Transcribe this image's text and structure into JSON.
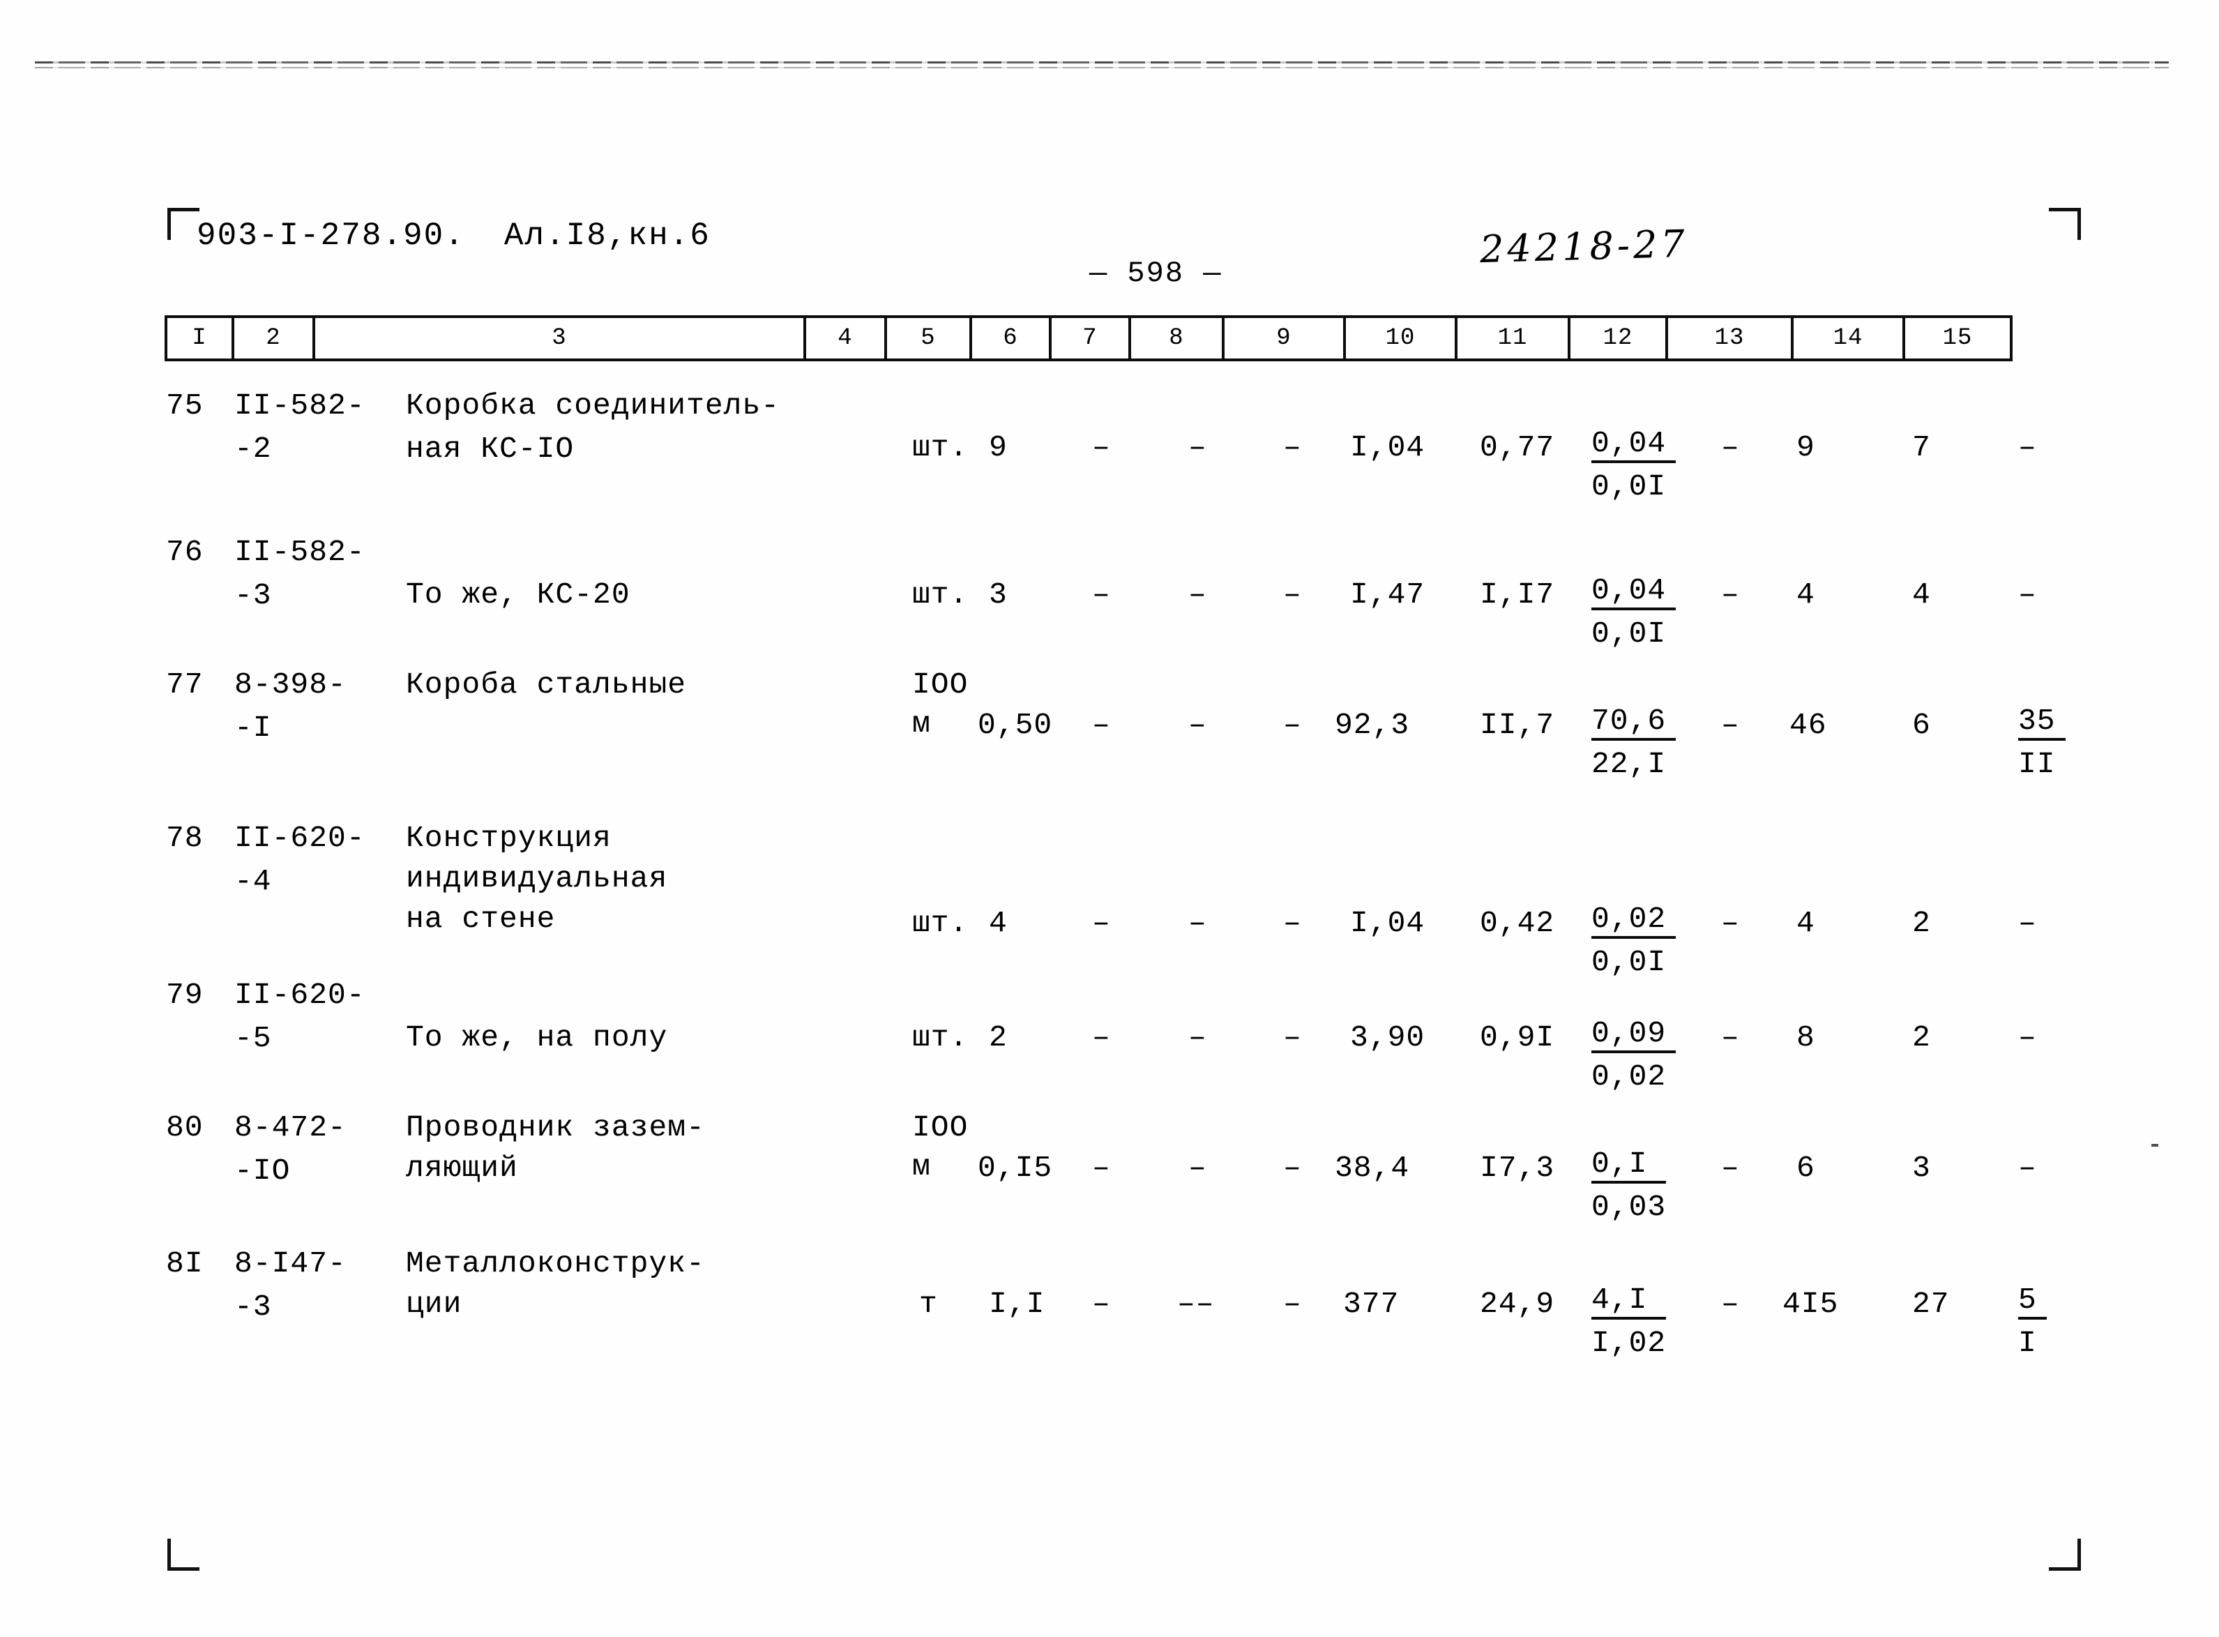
{
  "document": {
    "code": "903-I-278.90.",
    "album": "Ал.I8,кн.6",
    "page_label": "— 598 —",
    "stamp_number": "24218-27"
  },
  "table": {
    "column_headers": [
      "I",
      "2",
      "3",
      "4",
      "5",
      "6",
      "7",
      "8",
      "9",
      "10",
      "11",
      "12",
      "13",
      "14",
      "15"
    ],
    "rows": [
      {
        "num": "75",
        "code_line1": "II-582-",
        "code_line2": "-2",
        "name_line1": "Коробка соединитель-",
        "name_line2": "ная КС-IO",
        "name_line3": "",
        "unit_line1": "",
        "unit_line2": "шт.",
        "c5": "9",
        "c6": "–",
        "c7": "–",
        "c8": "–",
        "c9": "I,04",
        "c10": "0,77",
        "c11_top": "0,04",
        "c11_bot": "0,0I",
        "c12": "–",
        "c13": "9",
        "c14": "7",
        "c15_top": "–",
        "c15_bot": ""
      },
      {
        "num": "76",
        "code_line1": "II-582-",
        "code_line2": "-3",
        "name_line1": "",
        "name_line2": "То же, КС-20",
        "name_line3": "",
        "unit_line1": "",
        "unit_line2": "шт.",
        "c5": "3",
        "c6": "–",
        "c7": "–",
        "c8": "–",
        "c9": "I,47",
        "c10": "I,I7",
        "c11_top": "0,04",
        "c11_bot": "0,0I",
        "c12": "–",
        "c13": "4",
        "c14": "4",
        "c15_top": "–",
        "c15_bot": ""
      },
      {
        "num": "77",
        "code_line1": "8-398-",
        "code_line2": "-I",
        "name_line1": "Короба стальные",
        "name_line2": "",
        "name_line3": "",
        "unit_line1": "IOO",
        "unit_line2": "м",
        "c5": "0,50",
        "c6": "–",
        "c7": "–",
        "c8": "–",
        "c9": "92,3",
        "c10": "II,7",
        "c11_top": "70,6",
        "c11_bot": "22,I",
        "c12": "–",
        "c13": "46",
        "c14": "6",
        "c15_top": "35",
        "c15_bot": "II"
      },
      {
        "num": "78",
        "code_line1": "II-620-",
        "code_line2": "-4",
        "name_line1": "Конструкция",
        "name_line2": "индивидуальная",
        "name_line3": "на стене",
        "unit_line1": "",
        "unit_line2": "шт.",
        "c5": "4",
        "c6": "–",
        "c7": "–",
        "c8": "–",
        "c9": "I,04",
        "c10": "0,42",
        "c11_top": "0,02",
        "c11_bot": "0,0I",
        "c12": "–",
        "c13": "4",
        "c14": "2",
        "c15_top": "–",
        "c15_bot": ""
      },
      {
        "num": "79",
        "code_line1": "II-620-",
        "code_line2": "-5",
        "name_line1": "",
        "name_line2": "То же, на полу",
        "name_line3": "",
        "unit_line1": "",
        "unit_line2": "шт.",
        "c5": "2",
        "c6": "–",
        "c7": "–",
        "c8": "–",
        "c9": "3,90",
        "c10": "0,9I",
        "c11_top": "0,09",
        "c11_bot": "0,02",
        "c12": "–",
        "c13": "8",
        "c14": "2",
        "c15_top": "–",
        "c15_bot": ""
      },
      {
        "num": "80",
        "code_line1": "8-472-",
        "code_line2": "-IO",
        "name_line1": "Проводник зазем-",
        "name_line2": "ляющий",
        "name_line3": "",
        "unit_line1": "IOO",
        "unit_line2": "м",
        "c5": "0,I5",
        "c6": "–",
        "c7": "–",
        "c8": "–",
        "c9": "38,4",
        "c10": "I7,3",
        "c11_top": "0,I",
        "c11_bot": "0,03",
        "c12": "–",
        "c13": "6",
        "c14": "3",
        "c15_top": "–",
        "c15_bot": ""
      },
      {
        "num": "8I",
        "code_line1": "8-I47-",
        "code_line2": "-3",
        "name_line1": "Металлоконструк-",
        "name_line2": "ции",
        "name_line3": "",
        "unit_line1": "",
        "unit_line2": "т",
        "c5": "I,I",
        "c6": "–",
        "c7": "––",
        "c8": "–",
        "c9": "377",
        "c10": "24,9",
        "c11_top": "4,I",
        "c11_bot": "I,02",
        "c12": "–",
        "c13": "4I5",
        "c14": "27",
        "c15_top": "5",
        "c15_bot": "I"
      }
    ]
  }
}
